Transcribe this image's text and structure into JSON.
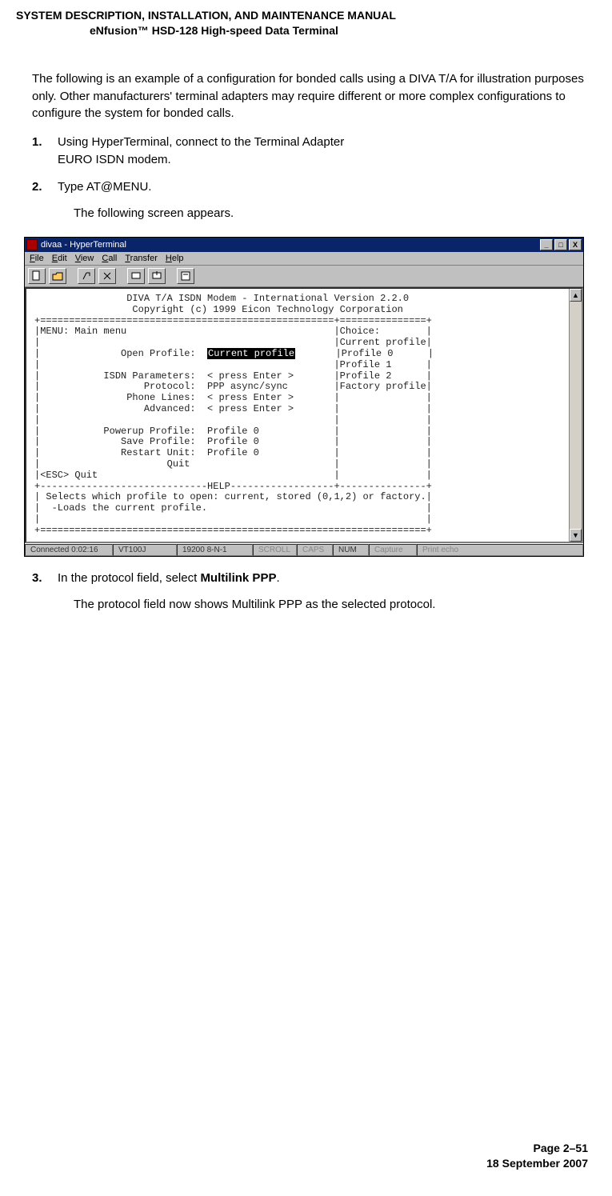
{
  "doc_header": {
    "line1": "SYSTEM DESCRIPTION, INSTALLATION, AND MAINTENANCE MANUAL",
    "line2": "eNfusion™ HSD-128 High-speed Data Terminal"
  },
  "intro": "The following is an example of a configuration for bonded calls using a DIVA T/A for illustration purposes only. Other manufacturers' terminal adapters may require different or more complex configurations to configure the system for bonded calls.",
  "steps": {
    "s1": {
      "num": "1.",
      "text": "Using HyperTerminal, connect to the Terminal Adapter\nEURO ISDN modem."
    },
    "s2": {
      "num": "2.",
      "text": "Type AT@MENU.",
      "follow": "The following screen appears."
    },
    "s3": {
      "num": "3.",
      "pre": "In the protocol field, select ",
      "bold": "Multilink PPP",
      "post": ".",
      "follow": "The protocol field now shows Multilink PPP as the selected protocol."
    }
  },
  "hyperterm": {
    "title": "divaa - HyperTerminal",
    "menus": {
      "file": "File",
      "edit": "Edit",
      "view": "View",
      "call": "Call",
      "transfer": "Transfer",
      "help": "Help"
    },
    "winbtns": {
      "min": "_",
      "max": "□",
      "close": "X"
    },
    "content": {
      "l1": "                DIVA T/A ISDN Modem - International Version 2.2.0",
      "l2": "                 Copyright (c) 1999 Eicon Technology Corporation",
      "l3": "+===================================================+===============+",
      "l4": "|MENU: Main menu                                    |Choice:        |",
      "l5": "|                                                   |Current profile|",
      "l6p": "|              Open Profile:  ",
      "l6i": "Current profile",
      "l6s": "       |Profile 0      |",
      "l7": "|                                                   |Profile 1      |",
      "l8": "|           ISDN Parameters:  < press Enter >       |Profile 2      |",
      "l9": "|                  Protocol:  PPP async/sync        |Factory profile|",
      "l10": "|               Phone Lines:  < press Enter >       |               |",
      "l11": "|                  Advanced:  < press Enter >       |               |",
      "l12": "|                                                   |               |",
      "l13": "|           Powerup Profile:  Profile 0             |               |",
      "l14": "|              Save Profile:  Profile 0             |               |",
      "l15": "|              Restart Unit:  Profile 0             |               |",
      "l16": "|                      Quit                         |               |",
      "l17": "|<ESC> Quit                                         |               |",
      "l18": "+-----------------------------HELP------------------+---------------+",
      "l19": "| Selects which profile to open: current, stored (0,1,2) or factory.|",
      "l20": "|  -Loads the current profile.                                      |",
      "l21": "|                                                                   |",
      "l22": "+===================================================================+"
    },
    "status": {
      "conn": "Connected 0:02:16",
      "term": "VT100J",
      "line": "19200 8-N-1",
      "scroll": "SCROLL",
      "caps": "CAPS",
      "num": "NUM",
      "capture": "Capture",
      "echo": "Print echo"
    }
  },
  "footer": {
    "page": "Page 2–51",
    "date": "18 September 2007"
  }
}
